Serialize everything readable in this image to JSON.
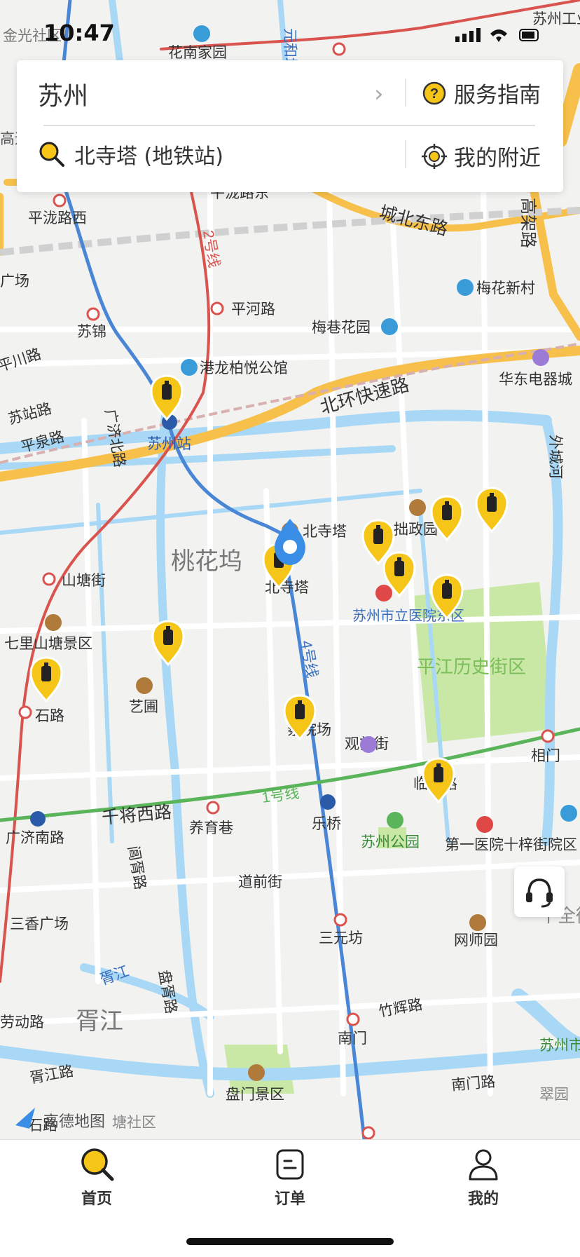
{
  "status_bar": {
    "time": "10:47"
  },
  "search_panel": {
    "city": "苏州",
    "guide_label": "服务指南",
    "search_text": "北寺塔 (地铁站)",
    "nearby_label": "我的附近"
  },
  "map": {
    "provider_logo": "高德地图",
    "labels": [
      "金光社区",
      "花南家园",
      "元和塘",
      "苏州工业园区",
      "高速",
      "平泷路西",
      "平泷路东",
      "2号线",
      "城北东路",
      "高架路",
      "梅花新村",
      "广场",
      "平河路",
      "梅巷花园",
      "苏锦",
      "平川路",
      "港龙柏悦公馆",
      "华东电器城",
      "苏站路",
      "北环快速路",
      "广济北路",
      "平泉路",
      "苏州站",
      "外城河",
      "拙政园",
      "北寺塔",
      "桃花坞",
      "北寺塔",
      "山塘街",
      "苏州市立医院东区",
      "七里山塘景区",
      "平江历史街区",
      "4号线",
      "石路",
      "艺圃",
      "察院场",
      "观前街",
      "相门",
      "临顿路",
      "1号线",
      "千将西路",
      "养育巷",
      "乐桥",
      "广济南路",
      "苏州公园",
      "第一医院十梓街院区",
      "阊胥路",
      "道前街",
      "三香广场",
      "三元坊",
      "网师园",
      "胥江",
      "盘胥路",
      "劳动路",
      "胥江",
      "竹辉路",
      "南门",
      "苏州市",
      "胥江路",
      "南门路",
      "盘门景区",
      "翠园",
      "塘社区",
      "石路",
      "十全街"
    ],
    "markers": [
      "locker-marker",
      "locker-marker",
      "locker-marker",
      "locker-marker",
      "locker-marker",
      "locker-marker",
      "locker-marker",
      "locker-marker",
      "locker-marker",
      "locker-marker",
      "locker-marker",
      "locker-marker"
    ],
    "selected_pin": "location-pin-icon"
  },
  "tabs": [
    {
      "label": "首页",
      "icon": "search-icon",
      "active": true
    },
    {
      "label": "订单",
      "icon": "order-icon",
      "active": false
    },
    {
      "label": "我的",
      "icon": "person-icon",
      "active": false
    }
  ],
  "colors": {
    "accent": "#f5c518",
    "map_bg": "#f2f2f0",
    "water": "#a8d8f5",
    "highway": "#f7c04a",
    "metro_blue": "#4a86d6",
    "metro_green": "#5ab45a",
    "metro_red": "#d9534f",
    "park": "#c9e8a5"
  }
}
